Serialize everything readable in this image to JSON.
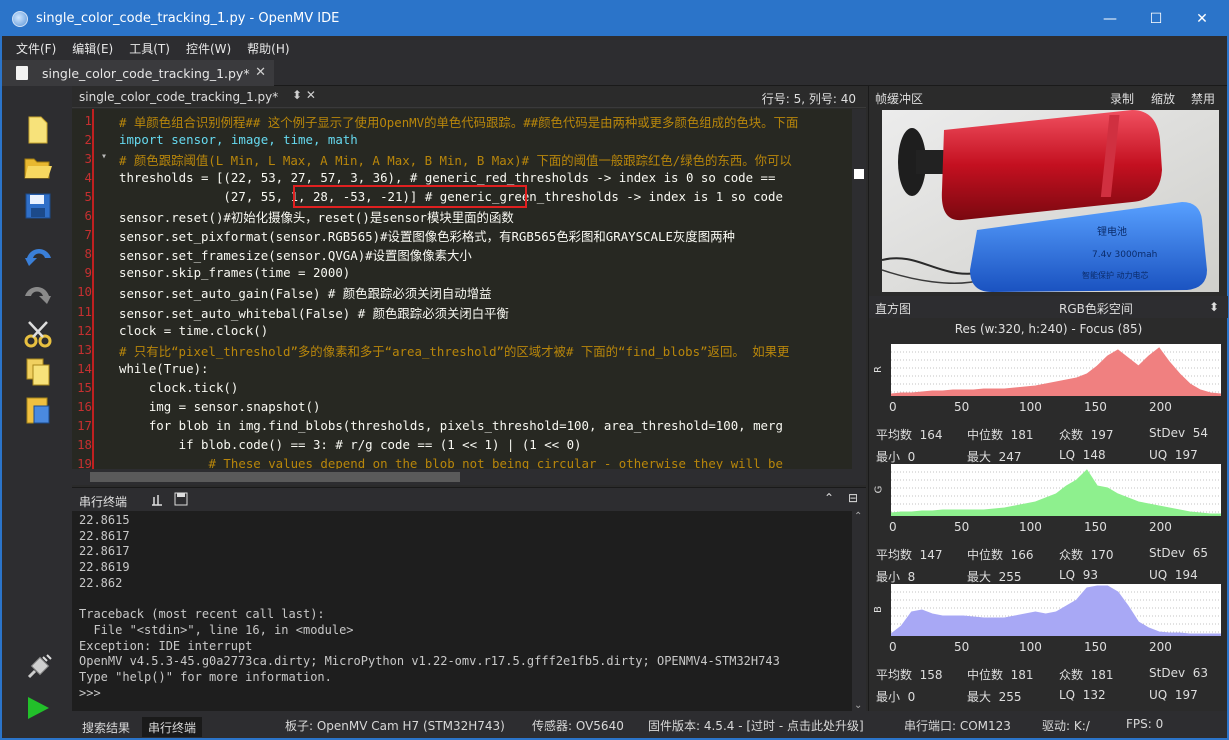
{
  "window": {
    "title": "single_color_code_tracking_1.py - OpenMV IDE",
    "minimize": "—",
    "maximize": "☐",
    "close": "✕"
  },
  "menu": [
    "文件(F)",
    "编辑(E)",
    "工具(T)",
    "控件(W)",
    "帮助(H)"
  ],
  "file_tab": {
    "label": "single_color_code_tracking_1.py*",
    "close": "✕"
  },
  "editor": {
    "filename": "single_color_code_tracking_1.py*",
    "controls": "⬍  ✕",
    "position": "行号: 5, 列号: 40",
    "lines": [
      "1",
      "2",
      "3",
      "4",
      "5",
      "6",
      "7",
      "8",
      "9",
      "10",
      "11",
      "12",
      "13",
      "14",
      "15",
      "16",
      "17",
      "18",
      "19"
    ],
    "code": [
      "# 单颜色组合识别例程## 这个例子显示了使用OpenMV的单色代码跟踪。##颜色代码是由两种或更多颜色组成的色块。下面",
      "import sensor, image, time, math",
      "# 颜色跟踪阈值(L Min, L Max, A Min, A Max, B Min, B Max)# 下面的阈值一般跟踪红色/绿色的东西。你可以",
      "thresholds = [(22, 53, 27, 57, 3, 36), # generic_red_thresholds -> index is 0 so code ==",
      "              (27, 55, 1, 28, -53, -21)] # generic_green_thresholds -> index is 1 so code",
      "sensor.reset()#初始化摄像头，reset()是sensor模块里面的函数",
      "sensor.set_pixformat(sensor.RGB565)#设置图像色彩格式，有RGB565色彩图和GRAYSCALE灰度图两种",
      "sensor.set_framesize(sensor.QVGA)#设置图像像素大小",
      "sensor.skip_frames(time = 2000)",
      "sensor.set_auto_gain(False) # 颜色跟踪必须关闭自动增益",
      "sensor.set_auto_whitebal(False) # 颜色跟踪必须关闭白平衡",
      "clock = time.clock()",
      "# 只有比“pixel_threshold”多的像素和多于“area_threshold”的区域才被# 下面的“find_blobs”返回。 如果更",
      "while(True):",
      "    clock.tick()",
      "    img = sensor.snapshot()",
      "    for blob in img.find_blobs(thresholds, pixels_threshold=100, area_threshold=100, merg",
      "        if blob.code() == 3: # r/g code == (1 << 1) | (1 << 0)",
      "            # These values depend on the blob not being circular - otherwise they will be"
    ]
  },
  "serial": {
    "title": "串行终端",
    "text": "22.8615\n22.8617\n22.8617\n22.8619\n22.862\n\nTraceback (most recent call last):\n  File \"<stdin>\", line 16, in <module>\nException: IDE interrupt\nOpenMV v4.5.3-45.g0a2773ca.dirty; MicroPython v1.22-omv.r17.5.gfff2e1fb5.dirty; OPENMV4-STM32H743\nType \"help()\" for more information.\n>>>"
  },
  "status": {
    "tab_search": "搜索结果",
    "tab_serial": "串行终端",
    "board": "板子: OpenMV Cam H7 (STM32H743)",
    "sensor": "传感器: OV5640",
    "firmware": "固件版本: 4.5.4 - [过时 - 点击此处升级]",
    "port": "串行端口: COM123",
    "drive": "驱动: K:/",
    "fps": "FPS: 0"
  },
  "framebuffer": {
    "title": "帧缓冲区",
    "record": "录制",
    "zoom": "缩放",
    "disable": "禁用",
    "battery_text1": "锂电池",
    "battery_text2": "7.4v 3000mah",
    "battery_text3": "智能保护 动力电芯"
  },
  "histogram": {
    "title": "直方图",
    "colorspace": "RGB色彩空间",
    "res": "Res (w:320, h:240) - Focus (85)",
    "ticks": [
      "0",
      "50",
      "100",
      "150",
      "200"
    ],
    "channels": [
      {
        "name": "R",
        "color": "#f08080",
        "mean": "164",
        "median": "181",
        "mode": "197",
        "stdev": "54",
        "min": "0",
        "max": "247",
        "lq": "148",
        "uq": "197"
      },
      {
        "name": "G",
        "color": "#8ef08e",
        "mean": "147",
        "median": "166",
        "mode": "170",
        "stdev": "65",
        "min": "8",
        "max": "255",
        "lq": "93",
        "uq": "194"
      },
      {
        "name": "B",
        "color": "#a8a8f5",
        "mean": "158",
        "median": "181",
        "mode": "181",
        "stdev": "63",
        "min": "0",
        "max": "255",
        "lq": "132",
        "uq": "197"
      }
    ],
    "labels": {
      "mean": "平均数",
      "median": "中位数",
      "mode": "众数",
      "stdev": "StDev",
      "min": "最小",
      "max": "最大",
      "lq": "LQ",
      "uq": "UQ"
    }
  }
}
